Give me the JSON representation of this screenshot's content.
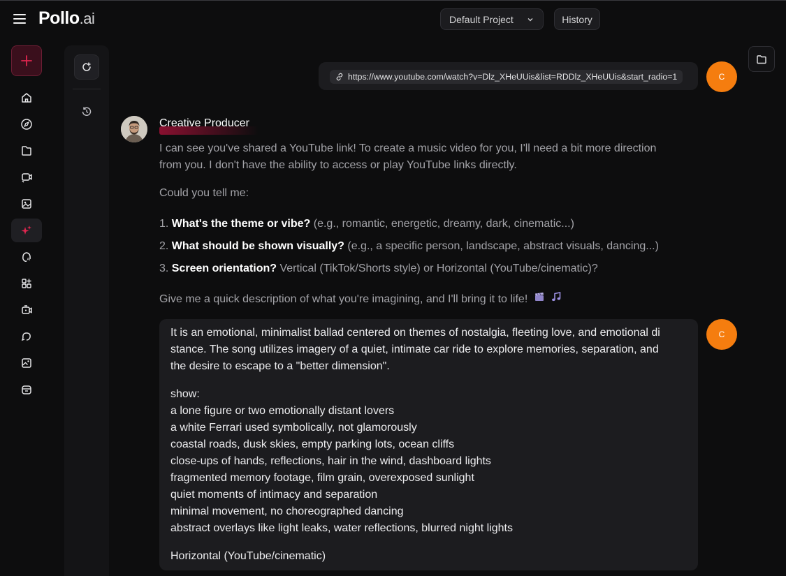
{
  "header": {
    "logo_main": "Pollo",
    "logo_suffix": ".ai",
    "project_select": "Default Project",
    "history_button": "History"
  },
  "nav": {
    "items": [
      "home-icon",
      "explore-icon",
      "folder-icon",
      "video-icon",
      "image-icon",
      "sparkle-icon",
      "ai-avatar-icon",
      "apps-icon",
      "ai-video-icon",
      "speech-icon",
      "gallery-icon",
      "store-icon"
    ]
  },
  "chat": {
    "user_initial": "C",
    "user_link": "https://www.youtube.com/watch?v=Dlz_XHeUUis&list=RDDlz_XHeUUis&start_radio=1",
    "bot_name": "Creative Producer",
    "bot_intro_1": "I can see you've shared a YouTube link! To create a music video for you, I'll need a bit more direction",
    "bot_intro_2": "from you. I don't have the ability to access or play YouTube links directly.",
    "bot_question": "Could you tell me:",
    "list": [
      {
        "num": "1.",
        "bold": "What's the theme or vibe?",
        "rest": " (e.g., romantic, energetic, dreamy, dark, cinematic...)"
      },
      {
        "num": "2.",
        "bold": "What should be shown visually?",
        "rest": " (e.g., a specific person, landscape, abstract visuals, dancing...)"
      },
      {
        "num": "3.",
        "bold": "Screen orientation?",
        "rest": " Vertical (TikTok/Shorts style) or Horizontal (YouTube/cinematic)?"
      }
    ],
    "bot_closing": "Give me a quick description of what you're imagining, and I'll bring it to life!",
    "user_reply": {
      "line1": "It is an emotional, minimalist ballad centered on themes of nostalgia, fleeting love, and emotional di",
      "line2": "stance. The song utilizes imagery of a quiet, intimate car ride to explore memories, separation, and",
      "line3": "the desire to escape to a \"better dimension\".",
      "show_label": "show:",
      "show_items": [
        "a lone figure or two emotionally distant lovers",
        "a white Ferrari used symbolically, not glamorously",
        "coastal roads, dusk skies, empty parking lots, ocean cliffs",
        "close-ups of hands, reflections, hair in the wind, dashboard lights",
        "fragmented memory footage, film grain, overexposed sunlight",
        "quiet moments of intimacy and separation",
        "minimal movement, no choreographed dancing",
        "abstract overlays like light leaks, water reflections, blurred night lights"
      ],
      "orientation": "Horizontal (YouTube/cinematic)"
    }
  },
  "colors": {
    "background": "#0d0d0e",
    "accent": "#e0264f",
    "user_avatar": "#f57d0f",
    "bubble": "#1c1c1f"
  }
}
